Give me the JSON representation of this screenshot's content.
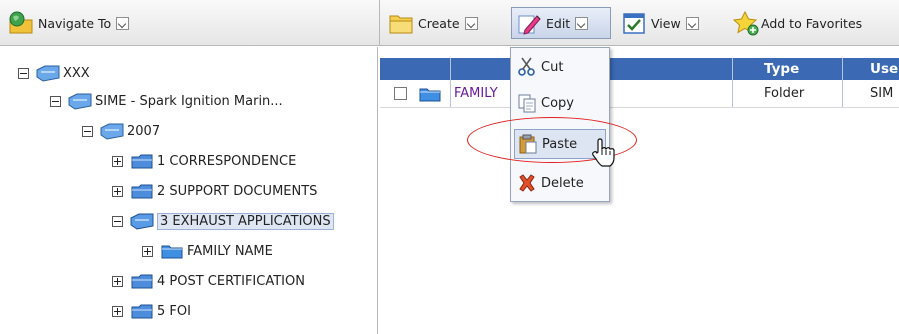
{
  "toolbar": {
    "navigate_label": "Navigate To",
    "create_label": "Create",
    "edit_label": "Edit",
    "view_label": "View",
    "favorites_label": "Add to Favorites"
  },
  "tree": {
    "root": "XXX",
    "level1": "SIME - Spark Ignition Marin...",
    "year": "2007",
    "items": [
      {
        "label": "1 CORRESPONDENCE"
      },
      {
        "label": "2 SUPPORT DOCUMENTS"
      },
      {
        "label": "3 EXHAUST APPLICATIONS"
      },
      {
        "label": "FAMILY NAME"
      },
      {
        "label": "4 POST CERTIFICATION"
      },
      {
        "label": "5 FOI"
      }
    ]
  },
  "grid": {
    "headers": [
      "Type",
      "Use"
    ],
    "row": {
      "name": "FAMILY",
      "type": "Folder",
      "user": "SIM"
    }
  },
  "menu": {
    "items": [
      "Cut",
      "Copy",
      "Paste",
      "Delete"
    ]
  },
  "colors": {
    "header_blue": "#3b69b3",
    "highlight_circle": "#e02020",
    "link_purple": "#6a1b9a"
  }
}
